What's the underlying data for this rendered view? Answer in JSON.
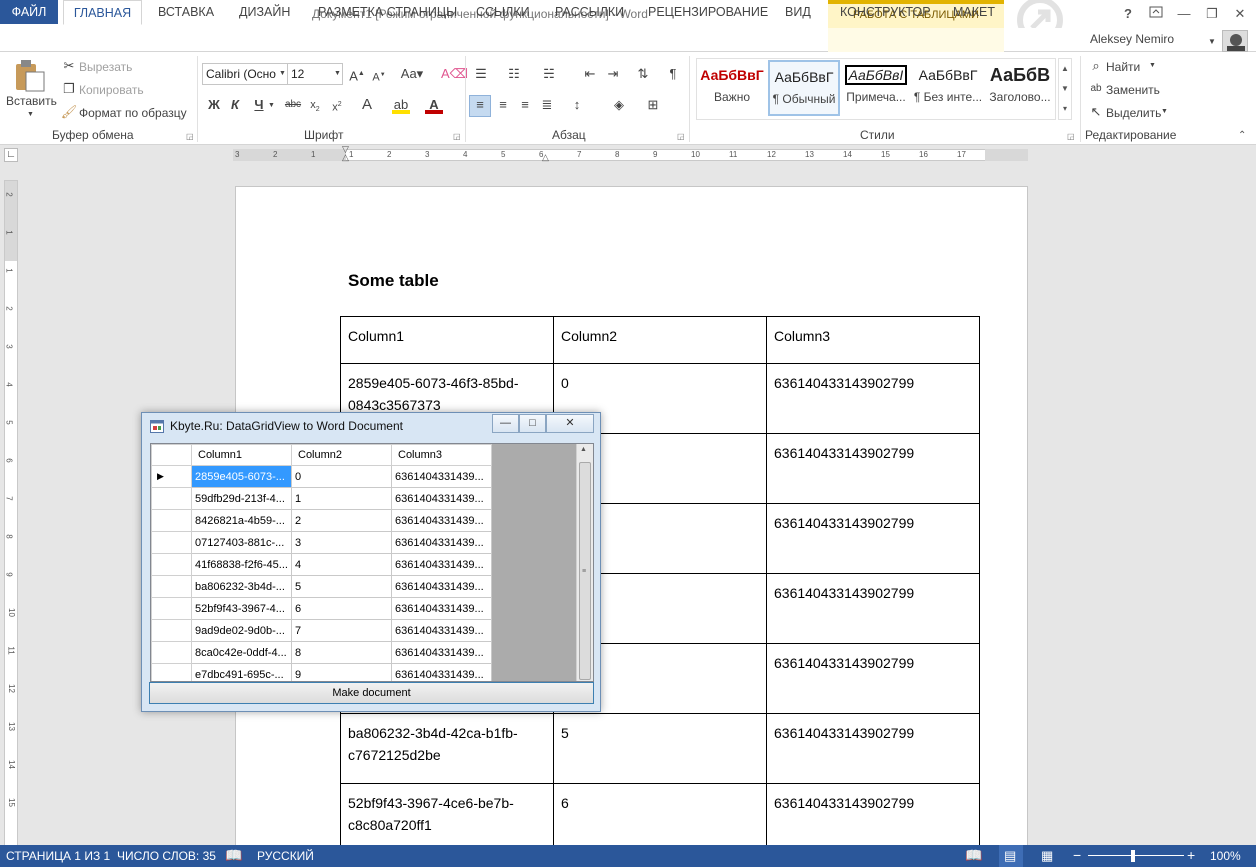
{
  "titlebar": {
    "app_icon": "W",
    "doc_title": "Документ1 [Режим ограниченной функциональности] - Word",
    "context_title": "РАБОТА С ТАБЛИЦАМИ",
    "help": "?",
    "user": "Aleksey Nemiro"
  },
  "tabs": [
    "ФАЙЛ",
    "ГЛАВНАЯ",
    "ВСТАВКА",
    "ДИЗАЙН",
    "РАЗМЕТКА СТРАНИЦЫ",
    "ССЫЛКИ",
    "РАССЫЛКИ",
    "РЕЦЕНЗИРОВАНИЕ",
    "ВИД",
    "КОНСТРУКТОР",
    "МАКЕТ"
  ],
  "clipboard": {
    "paste": "Вставить",
    "cut": "Вырезать",
    "copy": "Копировать",
    "format_painter": "Формат по образцу",
    "group": "Буфер обмена"
  },
  "font": {
    "name": "Calibri (Осно",
    "size": "12",
    "group": "Шрифт"
  },
  "paragraph": {
    "group": "Абзац"
  },
  "styles": {
    "group": "Стили",
    "items": [
      {
        "sample": "АаБбВвГ",
        "name": "Важно"
      },
      {
        "sample": "АаБбВвГ",
        "name": "¶ Обычный"
      },
      {
        "sample": "АаБбВвI",
        "name": "Примеча..."
      },
      {
        "sample": "АаБбВвГ",
        "name": "¶ Без инте..."
      },
      {
        "sample": "АаБбВ",
        "name": "Заголово..."
      }
    ]
  },
  "editing": {
    "find": "Найти",
    "replace": "Заменить",
    "select": "Выделить",
    "group": "Редактирование"
  },
  "ruler": {
    "h_marks": [
      "3",
      "2",
      "1",
      "1",
      "2",
      "3",
      "4",
      "5",
      "6",
      "7",
      "8",
      "9",
      "10",
      "11",
      "12",
      "13",
      "14",
      "15",
      "16",
      "17"
    ],
    "v_marks": [
      "2",
      "1",
      "1",
      "2",
      "3",
      "4",
      "5",
      "6",
      "7",
      "8",
      "9",
      "10",
      "11",
      "12",
      "13",
      "14",
      "15"
    ]
  },
  "document": {
    "heading": "Some table",
    "table": {
      "headers": [
        "Column1",
        "Column2",
        "Column3"
      ],
      "rows": [
        [
          "2859e405-6073-46f3-85bd-0843c3567373",
          "0",
          "636140433143902799"
        ],
        [
          "",
          "",
          "636140433143902799"
        ],
        [
          "",
          "",
          "636140433143902799"
        ],
        [
          "",
          "",
          "636140433143902799"
        ],
        [
          "",
          "",
          "636140433143902799"
        ],
        [
          "ba806232-3b4d-42ca-b1fb-c7672125d2be",
          "5",
          "636140433143902799"
        ],
        [
          "52bf9f43-3967-4ce6-be7b-c8c80a720ff1",
          "6",
          "636140433143902799"
        ]
      ]
    }
  },
  "statusbar": {
    "page": "СТРАНИЦА 1 ИЗ 1",
    "words": "ЧИСЛО СЛОВ: 35",
    "language": "РУССКИЙ",
    "zoom": "100%"
  },
  "dialog": {
    "title": "Kbyte.Ru: DataGridView to Word Document",
    "columns": [
      "Column1",
      "Column2",
      "Column3"
    ],
    "rows": [
      [
        "2859e405-6073-...",
        "0",
        "6361404331439..."
      ],
      [
        "59dfb29d-213f-4...",
        "1",
        "6361404331439..."
      ],
      [
        "8426821a-4b59-...",
        "2",
        "6361404331439..."
      ],
      [
        "07127403-881c-...",
        "3",
        "6361404331439..."
      ],
      [
        "41f68838-f2f6-45...",
        "4",
        "6361404331439..."
      ],
      [
        "ba806232-3b4d-...",
        "5",
        "6361404331439..."
      ],
      [
        "52bf9f43-3967-4...",
        "6",
        "6361404331439..."
      ],
      [
        "9ad9de02-9d0b-...",
        "7",
        "6361404331439..."
      ],
      [
        "8ca0c42e-0ddf-4...",
        "8",
        "6361404331439..."
      ],
      [
        "e7dbc491-695c-...",
        "9",
        "6361404331439..."
      ]
    ],
    "button": "Make document"
  }
}
